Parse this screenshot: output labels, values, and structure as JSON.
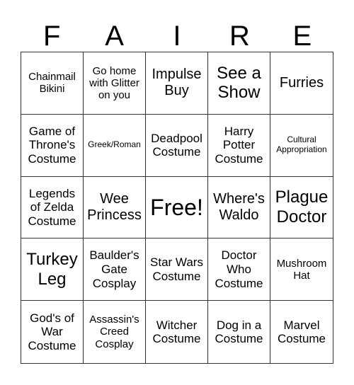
{
  "header": {
    "letters": [
      "F",
      "A",
      "I",
      "R",
      "E"
    ]
  },
  "cells": [
    {
      "text": "Chainmail Bikini",
      "size": "fs-s"
    },
    {
      "text": "Go home with Glitter on you",
      "size": "fs-s"
    },
    {
      "text": "Impulse Buy",
      "size": "fs-l"
    },
    {
      "text": "See a Show",
      "size": "fs-xl"
    },
    {
      "text": "Furries",
      "size": "fs-l"
    },
    {
      "text": "Game of Throne's Costume",
      "size": "fs-m"
    },
    {
      "text": "Greek/Roman",
      "size": "fs-xs"
    },
    {
      "text": "Deadpool Costume",
      "size": "fs-m"
    },
    {
      "text": "Harry Potter Costume",
      "size": "fs-m"
    },
    {
      "text": "Cultural Appropriation",
      "size": "fs-xs"
    },
    {
      "text": "Legends of Zelda Costume",
      "size": "fs-m"
    },
    {
      "text": "Wee Princess",
      "size": "fs-l"
    },
    {
      "text": "Free!",
      "size": "fs-xxl"
    },
    {
      "text": "Where's Waldo",
      "size": "fs-l"
    },
    {
      "text": "Plague Doctor",
      "size": "fs-xl"
    },
    {
      "text": "Turkey Leg",
      "size": "fs-xl"
    },
    {
      "text": "Baulder's Gate Cosplay",
      "size": "fs-m"
    },
    {
      "text": "Star Wars Costume",
      "size": "fs-m"
    },
    {
      "text": "Doctor Who Costume",
      "size": "fs-m"
    },
    {
      "text": "Mushroom Hat",
      "size": "fs-s"
    },
    {
      "text": "God's of War Costume",
      "size": "fs-m"
    },
    {
      "text": "Assassin's Creed Cosplay",
      "size": "fs-s"
    },
    {
      "text": "Witcher Costume",
      "size": "fs-m"
    },
    {
      "text": "Dog in a Costume",
      "size": "fs-m"
    },
    {
      "text": "Marvel Costume",
      "size": "fs-m"
    }
  ]
}
